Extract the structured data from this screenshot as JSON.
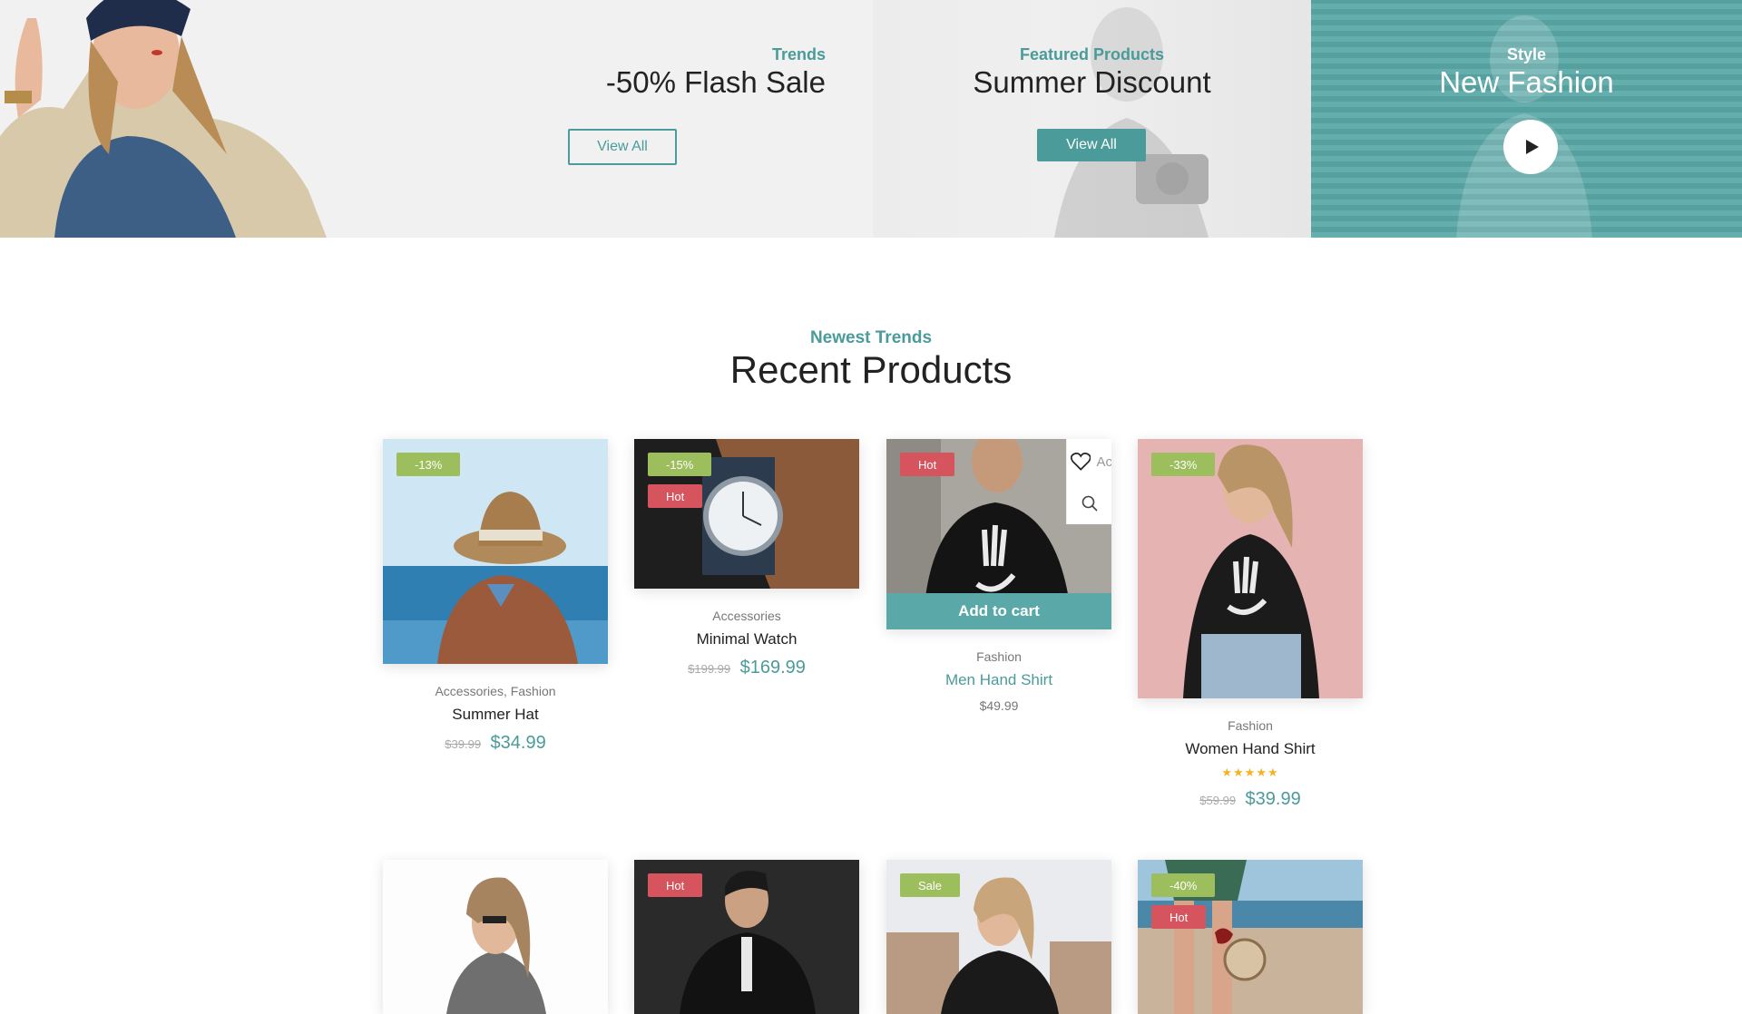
{
  "banners": [
    {
      "subtitle": "Trends",
      "title": "-50% Flash Sale",
      "button": "View All"
    },
    {
      "subtitle": "Featured Products",
      "title": "Summer Discount",
      "button": "View All"
    },
    {
      "subtitle": "Style",
      "title": "New Fashion",
      "button_icon": "play-icon"
    }
  ],
  "section": {
    "subtitle": "Newest Trends",
    "title": "Recent Products"
  },
  "products": [
    {
      "badges": [
        "-13%"
      ],
      "category": "Accessories, Fashion",
      "name": "Summer Hat",
      "old_price": "$39.99",
      "price": "$34.99"
    },
    {
      "badges": [
        "-15%",
        "Hot"
      ],
      "category": "Accessories",
      "name": "Minimal Watch",
      "old_price": "$199.99",
      "price": "$169.99"
    },
    {
      "badges": [
        "Hot"
      ],
      "category": "Fashion",
      "name": "Men Hand Shirt",
      "price": "$49.99",
      "add_to_cart": "Add to cart",
      "wishlist_label": "Ac"
    },
    {
      "badges": [
        "-33%"
      ],
      "category": "Fashion",
      "name": "Women Hand Shirt",
      "rating": 5,
      "old_price": "$59.99",
      "price": "$39.99"
    },
    {
      "badges": []
    },
    {
      "badges": [
        "Hot"
      ]
    },
    {
      "badges": [
        "Sale"
      ]
    },
    {
      "badges": [
        "-40%",
        "Hot"
      ]
    }
  ],
  "colors": {
    "accent": "#4a9b9a",
    "badge_green": "#9cbe5c",
    "badge_red": "#d6545e",
    "teal_panel": "#5aa9a8"
  }
}
